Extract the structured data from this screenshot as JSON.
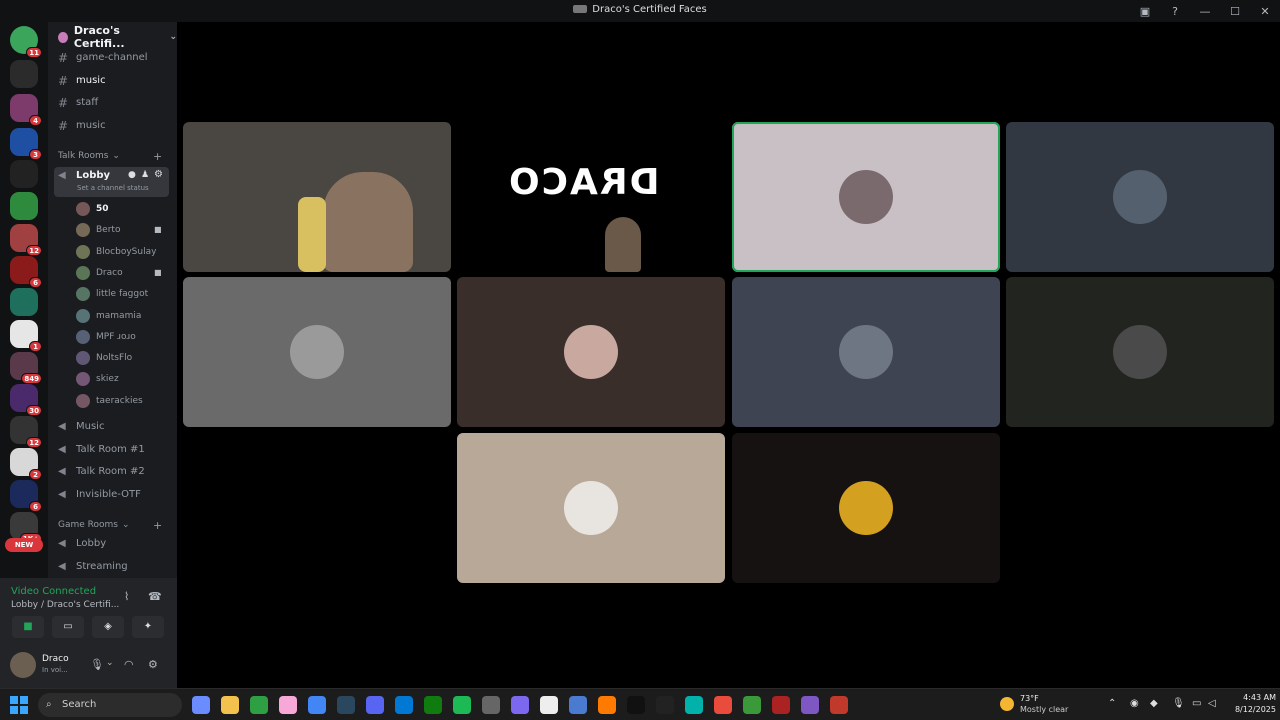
{
  "window": {
    "title": "Draco's Certified Faces"
  },
  "server": {
    "name": "Draco's Certifi..."
  },
  "channels_top": [
    {
      "name": "game-channel",
      "active": false
    },
    {
      "name": "music",
      "active": true
    },
    {
      "name": "staff",
      "active": false
    },
    {
      "name": "music",
      "active": false
    }
  ],
  "talk_rooms": {
    "category": "Talk Rooms",
    "lobby": {
      "name": "Lobby",
      "status": "Set a channel status"
    },
    "members": [
      {
        "name": "50",
        "cam": false
      },
      {
        "name": "Berto",
        "cam": true
      },
      {
        "name": "BlocboySulay",
        "cam": false
      },
      {
        "name": "Draco",
        "cam": true
      },
      {
        "name": "little faggot",
        "cam": false
      },
      {
        "name": "mamamia",
        "cam": false
      },
      {
        "name": "MPF ɹoɹo",
        "cam": false
      },
      {
        "name": "NoltsFlo",
        "cam": false
      },
      {
        "name": "skiez",
        "cam": false
      },
      {
        "name": "taerackies",
        "cam": false
      }
    ],
    "others": [
      "Music",
      "Talk Room #1",
      "Talk Room #2",
      "Invisible-OTF"
    ]
  },
  "game_rooms": {
    "category": "Game Rooms",
    "channels": [
      "Lobby",
      "Streaming"
    ]
  },
  "servers": [
    {
      "color": "#3ba55c",
      "badge": "11"
    },
    {
      "color": "#2b2b2b",
      "badge": ""
    },
    {
      "color": "#7c3b6a",
      "badge": "4"
    },
    {
      "color": "#1f4fa3",
      "badge": "3"
    },
    {
      "color": "#222222",
      "badge": ""
    },
    {
      "color": "#2e8b3e",
      "badge": ""
    },
    {
      "color": "#a04040",
      "badge": "12"
    },
    {
      "color": "#8b1a1a",
      "badge": "6"
    },
    {
      "color": "#1e6f5c",
      "badge": ""
    },
    {
      "color": "#e6e6e6",
      "badge": "1"
    },
    {
      "color": "#5a3a4a",
      "badge": "849"
    },
    {
      "color": "#4b2a6b",
      "badge": "30"
    },
    {
      "color": "#333333",
      "badge": "12"
    },
    {
      "color": "#d8d8d8",
      "badge": "2"
    },
    {
      "color": "#1b2a5a",
      "badge": "6"
    },
    {
      "color": "#3a3a3a",
      "badge": "1K+"
    }
  ],
  "new_badge": "NEW",
  "voice": {
    "status": "Video Connected",
    "location": "Lobby / Draco's Certifi..."
  },
  "user": {
    "name": "Draco",
    "state": "In voi..."
  },
  "tiles": [
    {
      "bg": "#4a4742",
      "kind": "video"
    },
    {
      "bg": "#000000",
      "kind": "logo",
      "logo_text": "DRACO"
    },
    {
      "bg": "#c8c0c4",
      "kind": "avatar",
      "avatar": "#7a6a6e",
      "speaking": true
    },
    {
      "bg": "#323842",
      "kind": "avatar",
      "avatar": "#55606e",
      "speaking": false
    },
    {
      "bg": "#6a6a6a",
      "kind": "avatar",
      "avatar": "#9a9a9a",
      "speaking": false
    },
    {
      "bg": "#3a2e2a",
      "kind": "avatar",
      "avatar": "#c9a8a0",
      "speaking": false
    },
    {
      "bg": "#3e4452",
      "kind": "avatar",
      "avatar": "#6e7684",
      "speaking": false
    },
    {
      "bg": "#22241f",
      "kind": "avatar",
      "avatar": "#4a4a4a",
      "speaking": false
    },
    {
      "bg": "#b8a898",
      "kind": "avatar",
      "avatar": "#e8e4e0",
      "speaking": false
    },
    {
      "bg": "#171212",
      "kind": "avatar",
      "avatar": "#d4a020",
      "speaking": false
    }
  ],
  "taskbar": {
    "search": "Search",
    "apps": [
      "#6b8cff",
      "#f2c14e",
      "#2ea043",
      "#f7a8d8",
      "#4285f4",
      "#2a475e",
      "#5865f2",
      "#0078d4",
      "#107c10",
      "#1db954",
      "#666666",
      "#7b68ee",
      "#eeeeee",
      "#4a7bd0",
      "#ff7a00",
      "#111111",
      "#222222",
      "#00b2a9",
      "#e94b3c",
      "#3a9a3a",
      "#aa2222",
      "#7e57c2",
      "#c0392b"
    ],
    "weather_temp": "73°F",
    "weather_desc": "Mostly clear",
    "time": "4:43 AM",
    "date": "8/12/2025"
  }
}
